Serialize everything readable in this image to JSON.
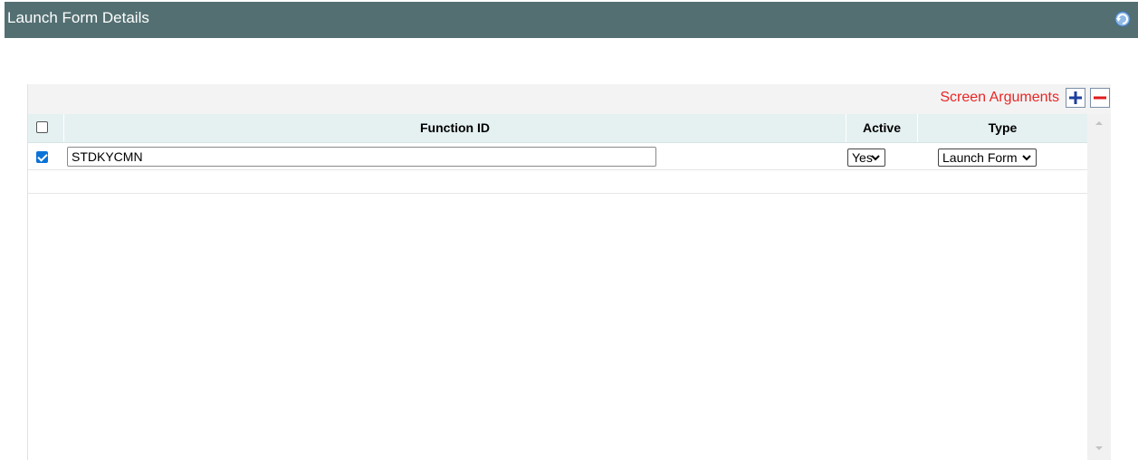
{
  "window": {
    "title": "Launch Form Details",
    "refresh_icon": "refresh-icon"
  },
  "toolbar": {
    "label": "Screen Arguments",
    "add_icon": "plus-icon",
    "remove_icon": "minus-icon",
    "label_color": "#ea2525"
  },
  "grid": {
    "columns": [
      "",
      "Function ID",
      "Active",
      "Type"
    ],
    "rows": [
      {
        "selected": true,
        "function_id": "STDKYCMN",
        "active": "Yes",
        "type": "Launch Form"
      }
    ]
  },
  "colors": {
    "header_bar": "#536f72",
    "grid_header": "#e5f0f1",
    "checkbox_accent": "#0b73d8"
  }
}
